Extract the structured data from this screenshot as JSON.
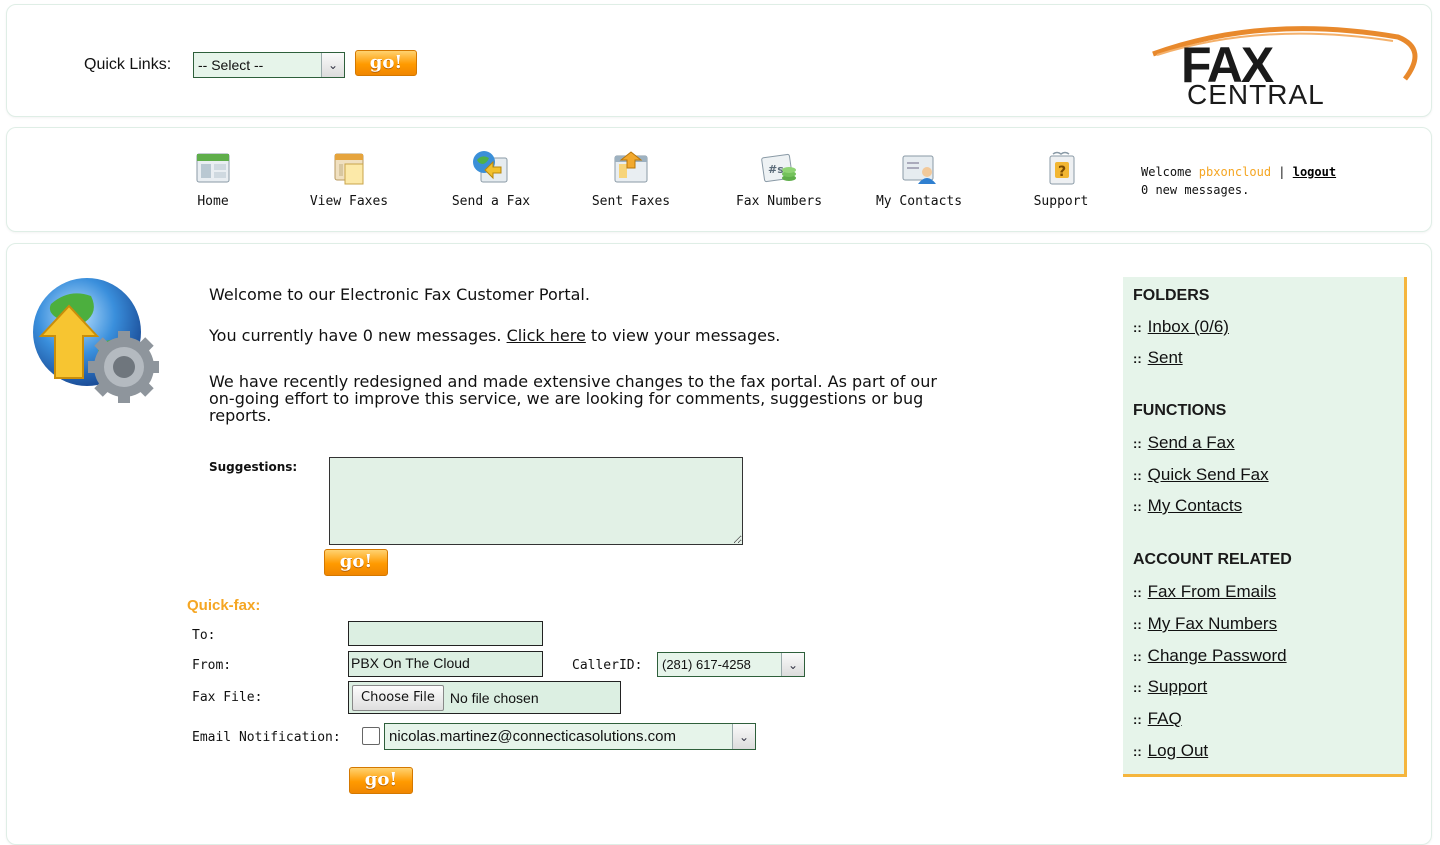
{
  "top": {
    "quick_links_label": "Quick Links:",
    "quick_links_selected": "-- Select --",
    "go_label": "go!",
    "logo": {
      "line1": "FAX",
      "line2": "CENTRAL"
    }
  },
  "nav": {
    "items": [
      {
        "label": "Home",
        "icon": "home-icon"
      },
      {
        "label": "View Faxes",
        "icon": "view-faxes-icon"
      },
      {
        "label": "Send a Fax",
        "icon": "send-fax-icon"
      },
      {
        "label": "Sent Faxes",
        "icon": "sent-faxes-icon"
      },
      {
        "label": "Fax Numbers",
        "icon": "fax-numbers-icon"
      },
      {
        "label": "My Contacts",
        "icon": "contacts-icon"
      },
      {
        "label": "Support",
        "icon": "support-icon"
      }
    ],
    "welcome_prefix": "Welcome ",
    "username": "pbxoncloud",
    "separator": " | ",
    "logout_label": "logout",
    "new_messages": "0 new messages."
  },
  "main": {
    "intro": "Welcome to our Electronic Fax Customer Portal.",
    "messages_prefix": "You currently have 0 new messages. ",
    "click_here": "Click here",
    "messages_suffix": " to view your messages.",
    "redesign_line1": "We have recently redesigned and made extensive changes to the fax portal. As part of our",
    "redesign_line2": "on-going effort to improve this service, we are looking for comments, suggestions or bug",
    "redesign_line3": "reports.",
    "suggestions_label": "Suggestions:",
    "suggestions_value": "",
    "go_label": "go!"
  },
  "quickfax": {
    "title": "Quick-fax:",
    "to_label": "To:",
    "to_value": "",
    "from_label": "From:",
    "from_value": "PBX On The Cloud",
    "callerid_label": "CallerID:",
    "callerid_value": "(281) 617-4258",
    "file_label": "Fax File:",
    "file_button": "Choose File",
    "file_status": "No file chosen",
    "email_label": "Email Notification:",
    "email_value": "nicolas.martinez@connecticasolutions.com",
    "email_checked": false,
    "go_label": "go!"
  },
  "sidebar": {
    "folders_title": "FOLDERS",
    "folders": [
      "Inbox (0/6)",
      "Sent"
    ],
    "functions_title": "FUNCTIONS",
    "functions": [
      "Send a Fax",
      "Quick Send Fax",
      "My Contacts"
    ],
    "account_title": "ACCOUNT RELATED",
    "account": [
      "Fax From Emails",
      "My Fax Numbers",
      "Change Password",
      "Support",
      "FAQ",
      "Log Out"
    ],
    "bullet": "::"
  },
  "colors": {
    "accent_orange": "#f5a623",
    "field_green": "#dcefe2",
    "sidebar_bg": "#e6f4ea"
  }
}
